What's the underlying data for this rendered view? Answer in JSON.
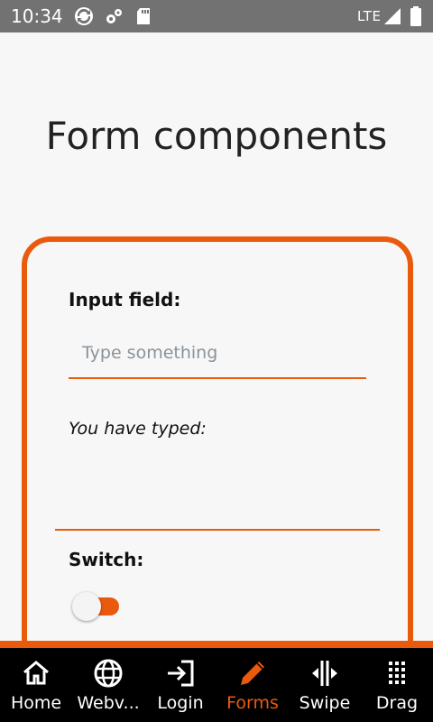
{
  "status_bar": {
    "time": "10:34",
    "network": "LTE",
    "icons": [
      "sync-icon",
      "settings-gear-icon",
      "sd-card-icon",
      "signal-icon",
      "battery-icon"
    ]
  },
  "page": {
    "title": "Form components"
  },
  "form": {
    "input_label": "Input field:",
    "input_placeholder": "Type something",
    "input_value": "",
    "typed_label": "You have typed:",
    "typed_value": "",
    "switch_label": "Switch:",
    "switch_on": true
  },
  "tabs": [
    {
      "label": "Home",
      "icon": "home-icon",
      "active": false
    },
    {
      "label": "Webv...",
      "icon": "globe-icon",
      "active": false
    },
    {
      "label": "Login",
      "icon": "login-icon",
      "active": false
    },
    {
      "label": "Forms",
      "icon": "pencil-icon",
      "active": true
    },
    {
      "label": "Swipe",
      "icon": "swipe-icon",
      "active": false
    },
    {
      "label": "Drag",
      "icon": "grid-dots-icon",
      "active": false
    }
  ],
  "colors": {
    "accent": "#ea5a0c",
    "status_bar": "#727272",
    "tab_bar": "#000000",
    "background": "#f7f7f7"
  }
}
